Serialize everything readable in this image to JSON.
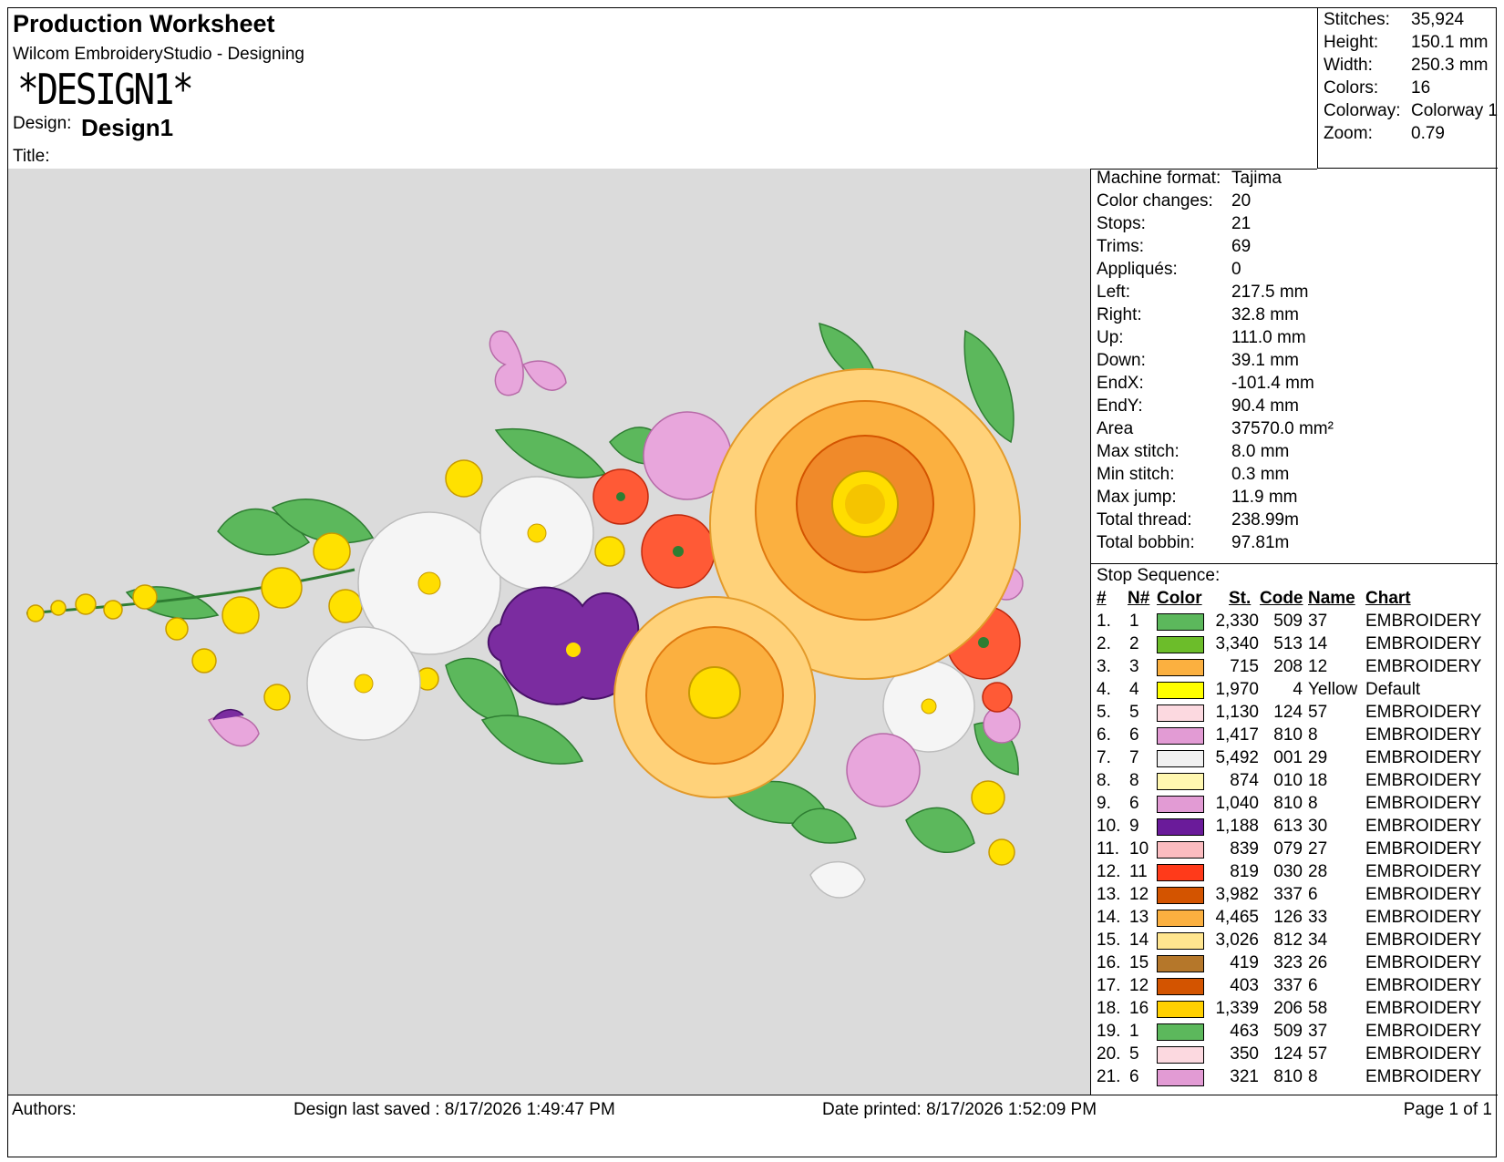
{
  "header": {
    "title": "Production Worksheet",
    "app": "Wilcom EmbroideryStudio - Designing",
    "design_display": "*DESIGN1*",
    "design_label": "Design:",
    "design_value": "Design1",
    "title_label": "Title:"
  },
  "stats": [
    {
      "label": "Stitches:",
      "value": "35,924"
    },
    {
      "label": "Height:",
      "value": "150.1 mm"
    },
    {
      "label": "Width:",
      "value": "250.3 mm"
    },
    {
      "label": "Colors:",
      "value": "16"
    },
    {
      "label": "Colorway:",
      "value": "Colorway 1"
    },
    {
      "label": "Zoom:",
      "value": "0.79"
    }
  ],
  "info": [
    {
      "label": "Machine format:",
      "value": "Tajima"
    },
    {
      "label": "Color changes:",
      "value": "20"
    },
    {
      "label": "Stops:",
      "value": "21"
    },
    {
      "label": "Trims:",
      "value": "69"
    },
    {
      "label": "Appliqués:",
      "value": "0"
    },
    {
      "label": "Left:",
      "value": "217.5 mm"
    },
    {
      "label": "Right:",
      "value": "32.8 mm"
    },
    {
      "label": "Up:",
      "value": "111.0 mm"
    },
    {
      "label": "Down:",
      "value": "39.1 mm"
    },
    {
      "label": "EndX:",
      "value": "-101.4 mm"
    },
    {
      "label": "EndY:",
      "value": "90.4 mm"
    },
    {
      "label": "Area",
      "value": "37570.0 mm²"
    },
    {
      "label": "Max stitch:",
      "value": "8.0 mm"
    },
    {
      "label": "Min stitch:",
      "value": "0.3 mm"
    },
    {
      "label": "Max jump:",
      "value": "11.9 mm"
    },
    {
      "label": "Total thread:",
      "value": "238.99m"
    },
    {
      "label": "Total bobbin:",
      "value": "97.81m"
    }
  ],
  "stop_sequence": {
    "label": "Stop Sequence:",
    "columns": {
      "num": "#",
      "n": "N#",
      "color": "Color",
      "st": "St.",
      "code": "Code",
      "name": "Name",
      "chart": "Chart"
    },
    "rows": [
      {
        "num": "1.",
        "n": "1",
        "color": "#5cb85c",
        "st": "2,330",
        "code": "509",
        "name": "37",
        "chart": "EMBROIDERY"
      },
      {
        "num": "2.",
        "n": "2",
        "color": "#6cbd2a",
        "st": "3,340",
        "code": "513",
        "name": "14",
        "chart": "EMBROIDERY"
      },
      {
        "num": "3.",
        "n": "3",
        "color": "#fbb040",
        "st": "715",
        "code": "208",
        "name": "12",
        "chart": "EMBROIDERY"
      },
      {
        "num": "4.",
        "n": "4",
        "color": "#ffff00",
        "st": "1,970",
        "code": "4",
        "name": "Yellow",
        "chart": "Default"
      },
      {
        "num": "5.",
        "n": "5",
        "color": "#fcd9e0",
        "st": "1,130",
        "code": "124",
        "name": "57",
        "chart": "EMBROIDERY"
      },
      {
        "num": "6.",
        "n": "6",
        "color": "#e29bd4",
        "st": "1,417",
        "code": "810",
        "name": "8",
        "chart": "EMBROIDERY"
      },
      {
        "num": "7.",
        "n": "7",
        "color": "#f0f0f0",
        "st": "5,492",
        "code": "001",
        "name": "29",
        "chart": "EMBROIDERY"
      },
      {
        "num": "8.",
        "n": "8",
        "color": "#fff7b0",
        "st": "874",
        "code": "010",
        "name": "18",
        "chart": "EMBROIDERY"
      },
      {
        "num": "9.",
        "n": "6",
        "color": "#e29bd4",
        "st": "1,040",
        "code": "810",
        "name": "8",
        "chart": "EMBROIDERY"
      },
      {
        "num": "10.",
        "n": "9",
        "color": "#6a1b9a",
        "st": "1,188",
        "code": "613",
        "name": "30",
        "chart": "EMBROIDERY"
      },
      {
        "num": "11.",
        "n": "10",
        "color": "#fbbcc0",
        "st": "839",
        "code": "079",
        "name": "27",
        "chart": "EMBROIDERY"
      },
      {
        "num": "12.",
        "n": "11",
        "color": "#ff3a1a",
        "st": "819",
        "code": "030",
        "name": "28",
        "chart": "EMBROIDERY"
      },
      {
        "num": "13.",
        "n": "12",
        "color": "#d35400",
        "st": "3,982",
        "code": "337",
        "name": "6",
        "chart": "EMBROIDERY"
      },
      {
        "num": "14.",
        "n": "13",
        "color": "#fbb040",
        "st": "4,465",
        "code": "126",
        "name": "33",
        "chart": "EMBROIDERY"
      },
      {
        "num": "15.",
        "n": "14",
        "color": "#ffe58f",
        "st": "3,026",
        "code": "812",
        "name": "34",
        "chart": "EMBROIDERY"
      },
      {
        "num": "16.",
        "n": "15",
        "color": "#b5772a",
        "st": "419",
        "code": "323",
        "name": "26",
        "chart": "EMBROIDERY"
      },
      {
        "num": "17.",
        "n": "12",
        "color": "#d35400",
        "st": "403",
        "code": "337",
        "name": "6",
        "chart": "EMBROIDERY"
      },
      {
        "num": "18.",
        "n": "16",
        "color": "#ffd000",
        "st": "1,339",
        "code": "206",
        "name": "58",
        "chart": "EMBROIDERY"
      },
      {
        "num": "19.",
        "n": "1",
        "color": "#5cb85c",
        "st": "463",
        "code": "509",
        "name": "37",
        "chart": "EMBROIDERY"
      },
      {
        "num": "20.",
        "n": "5",
        "color": "#fcd9e0",
        "st": "350",
        "code": "124",
        "name": "57",
        "chart": "EMBROIDERY"
      },
      {
        "num": "21.",
        "n": "6",
        "color": "#e29bd4",
        "st": "321",
        "code": "810",
        "name": "8",
        "chart": "EMBROIDERY"
      }
    ]
  },
  "footer": {
    "authors": "Authors:",
    "saved": "Design last saved : 8/17/2026 1:49:47 PM",
    "printed": "Date printed: 8/17/2026 1:52:09 PM",
    "page": "Page 1 of 1"
  },
  "canvas": {
    "background": "#dbdbdb",
    "artwork": "floral-embroidery-design"
  }
}
